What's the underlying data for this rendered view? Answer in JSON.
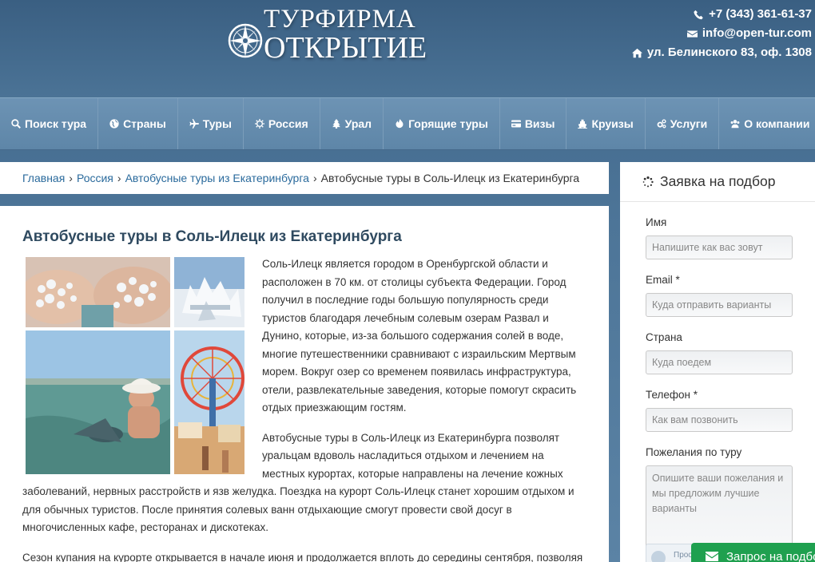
{
  "header": {
    "logo_top": "ТУРФИРМА",
    "logo_bottom": "ОТКРЫТИЕ",
    "phone": "+7 (343) 361-61-37",
    "email": "info@open-tur.com",
    "address": "ул. Белинского 83, оф. 1308"
  },
  "nav": {
    "items": [
      {
        "label": "Поиск тура",
        "icon": "search-icon"
      },
      {
        "label": "Страны",
        "icon": "globe-icon"
      },
      {
        "label": "Туры",
        "icon": "plane-icon"
      },
      {
        "label": "Россия",
        "icon": "sun-icon"
      },
      {
        "label": "Урал",
        "icon": "tree-icon"
      },
      {
        "label": "Горящие туры",
        "icon": "flame-icon"
      },
      {
        "label": "Визы",
        "icon": "credit-card-icon"
      },
      {
        "label": "Круизы",
        "icon": "ship-icon"
      },
      {
        "label": "Услуги",
        "icon": "gears-icon"
      },
      {
        "label": "О компании",
        "icon": "users-icon"
      }
    ]
  },
  "breadcrumb": {
    "items": [
      "Главная",
      "Россия",
      "Автобусные туры из Екатеринбурга"
    ],
    "current": "Автобусные туры в Соль-Илецк из Екатеринбурга",
    "separator": "›"
  },
  "main": {
    "title": "Автобусные туры в Соль-Илецк из Екатеринбурга",
    "paragraphs": [
      "Соль-Илецк является городом в Оренбургской области и расположен в 70 км. от столицы субъекта Федерации. Город получил в последние годы большую популярность среди туристов благодаря лечебным солевым озерам Развал и Дунино, которые, из-за большого содержания солей в воде, многие путешественники сравнивают с израильским Мертвым морем. Вокруг озер со временем появилась инфраструктура, отели, развлекательные заведения, которые помогут скрасить отдых приезжающим гостям.",
      "Автобусные туры в Соль-Илецк из Екатеринбурга позволят уральцам вдоволь насладиться отдыхом и лечением на местных курортах, которые направлены на лечение кожных заболеваний, нервных расстройств и язв желудка. Поездка на курорт Соль-Илецк станет хорошим отдыхом и для обычных туристов. После принятия солевых ванн отдыхающие смогут провести свой досуг в многочисленных кафе, ресторанах и дискотеках.",
      "Сезон купания на курорте открывается в начале июня и продолжается вплоть до середины сентября, позволяя"
    ]
  },
  "sidebar": {
    "title": "Заявка на подбор",
    "fields": [
      {
        "label": "Имя",
        "placeholder": "Напишите как вас зовут"
      },
      {
        "label": "Email *",
        "placeholder": "Куда отправить варианты"
      },
      {
        "label": "Страна",
        "placeholder": "Куда поедем"
      },
      {
        "label": "Телефон *",
        "placeholder": "Как вам позвонить"
      }
    ],
    "wishes_label": "Пожелания по туру",
    "wishes_placeholder": "Опишите ваши пожелания и мы предложим лучшие варианты",
    "captcha_text": "Прос",
    "submit_label": "Запрос на подбор"
  },
  "colors": {
    "header_bg": "#3e6589",
    "nav_bg": "#6d93b4",
    "link": "#2a6a9c",
    "submit_green": "#1fa04f"
  }
}
